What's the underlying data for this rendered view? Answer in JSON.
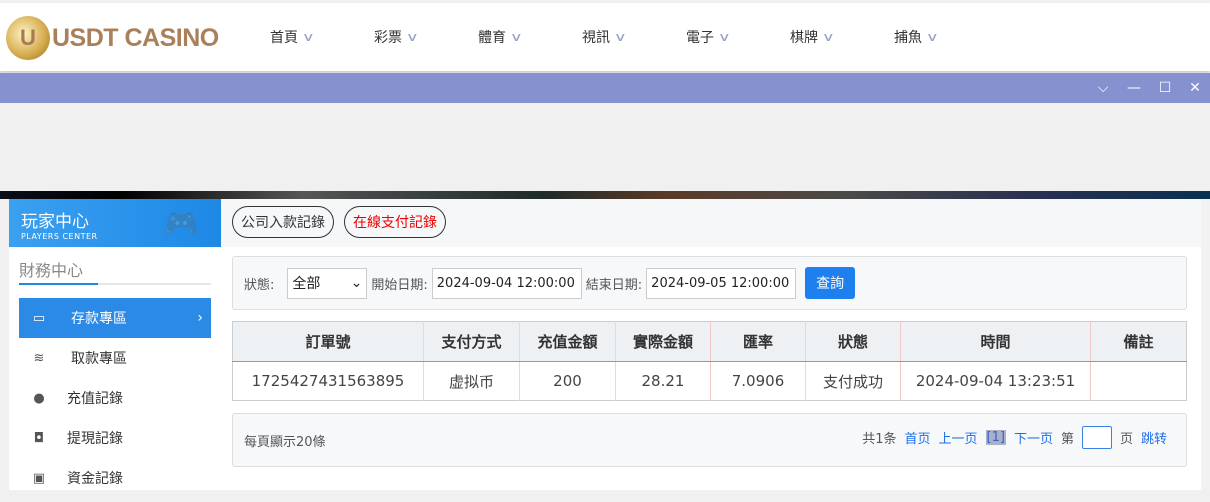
{
  "header": {
    "logo_text": "USDT CASINO",
    "logo_letter": "U",
    "nav": [
      "首頁",
      "彩票",
      "體育",
      "視訊",
      "電子",
      "棋牌",
      "捕魚"
    ]
  },
  "window": {
    "controls": [
      "chevron-down",
      "minimize",
      "maximize",
      "close"
    ]
  },
  "sidebar": {
    "title": "玩家中心",
    "subtitle": "PLAYERS CENTER",
    "section": "財務中心",
    "items": [
      {
        "label": "存款專區",
        "icon": "card-icon",
        "active": true
      },
      {
        "label": "取款專區",
        "icon": "hand-money-icon"
      },
      {
        "label": "充值記錄",
        "icon": "money-bag-icon"
      },
      {
        "label": "提現記錄",
        "icon": "wallet-icon"
      },
      {
        "label": "資金記錄",
        "icon": "coins-icon"
      }
    ]
  },
  "tabs": [
    "公司入款記錄",
    "在線支付記錄"
  ],
  "filter": {
    "status_label": "狀態:",
    "status_value": "全部",
    "start_label": "開始日期:",
    "start_value": "2024-09-04 12:00:00",
    "end_label": "結束日期:",
    "end_value": "2024-09-05 12:00:00",
    "query": "查詢"
  },
  "table": {
    "headers": [
      "訂單號",
      "支付方式",
      "充值金額",
      "實際金額",
      "匯率",
      "狀態",
      "時間",
      "備註"
    ],
    "rows": [
      [
        "1725427431563895",
        "虚拟币",
        "200",
        "28.21",
        "7.0906",
        "支付成功",
        "2024-09-04 13:23:51",
        ""
      ]
    ]
  },
  "pager": {
    "per_page": "每頁顯示20條",
    "total": "共1条",
    "first": "首页",
    "prev": "上一页",
    "current": "[1]",
    "next": "下一页",
    "goto_prefix": "第",
    "goto_suffix": "页",
    "goto": "跳转"
  },
  "colors": {
    "accent": "#1e88e5",
    "window_bar": "#8592cf",
    "tab_red": "#ee0000"
  }
}
